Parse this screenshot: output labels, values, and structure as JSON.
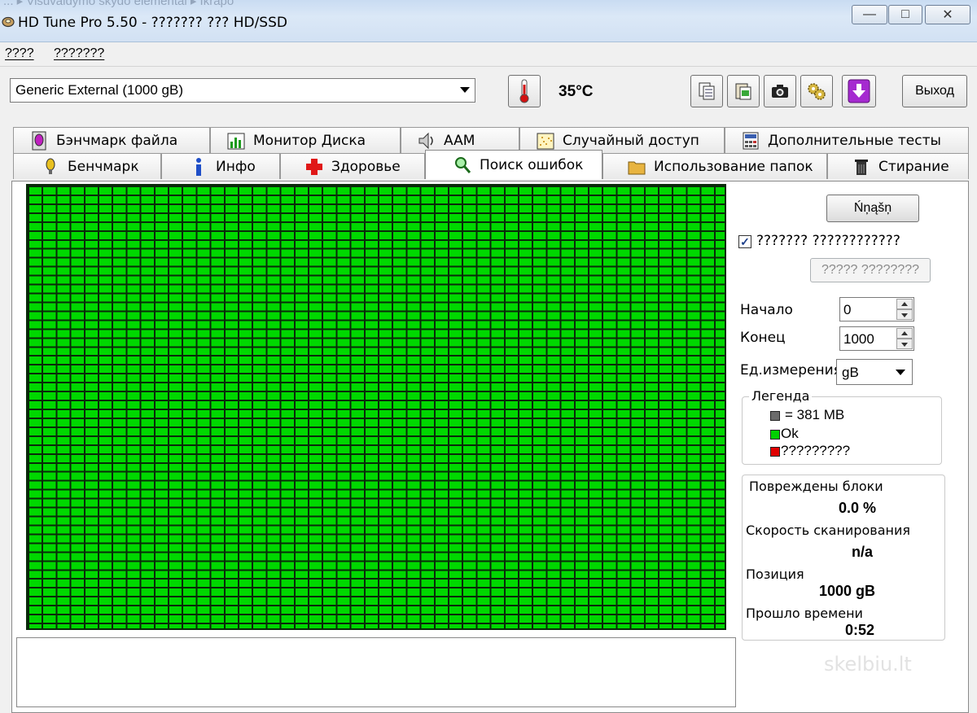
{
  "window": {
    "background_text": "... ▸ Visuvaldymo skydo elementai ▸ Ikrapo",
    "title": "HD Tune Pro 5.50 - ??????? ??? HD/SSD",
    "minimize_glyph": "—",
    "maximize_glyph": "□",
    "close_glyph": "✕"
  },
  "menu": {
    "items": [
      "????",
      "???????"
    ]
  },
  "toolbar": {
    "drive": "Generic External (1000 gB)",
    "temperature": "35°C",
    "exit_label": "Выход"
  },
  "tabs": {
    "top_row": [
      "Бэнчмарк файла",
      "Монитор Диска",
      "AAM",
      "Случайный доступ",
      "Дополнительные  тесты"
    ],
    "bottom_row": [
      "Бенчмарк",
      "Инфо",
      "Здоровье",
      "Поиск ошибок",
      "Использование папок",
      "Стирание"
    ],
    "active": "Поиск ошибок"
  },
  "scan_panel": {
    "start_button": "Ńņąšņ",
    "quick_scan_checked": true,
    "quick_scan_label": "??????? ????????????",
    "save_log_button": "????? ????????",
    "start_label": "Начало",
    "start_value": "0",
    "end_label": "Конец",
    "end_value": "1000",
    "unit_label": "Ед.измерения",
    "unit_value": "gB",
    "legend_title": "Легенда",
    "legend": [
      {
        "color": "#6b6b6b",
        "text": "= 381 MB"
      },
      {
        "color": "#00d000",
        "text": "Ok"
      },
      {
        "color": "#e00000",
        "text": "?????????"
      }
    ],
    "stats": {
      "damaged_label": "Повреждены блоки",
      "damaged_value": "0.0 %",
      "speed_label": "Скорость сканирования",
      "speed_value": "n/a",
      "position_label": "Позиция",
      "position_value": "1000 gB",
      "elapsed_label": "Прошло времени",
      "elapsed_value": "0:52"
    }
  },
  "colors": {
    "block_ok": "#00d800",
    "grid_line": "#0a2a0a"
  },
  "watermark": "skelbiu.lt"
}
